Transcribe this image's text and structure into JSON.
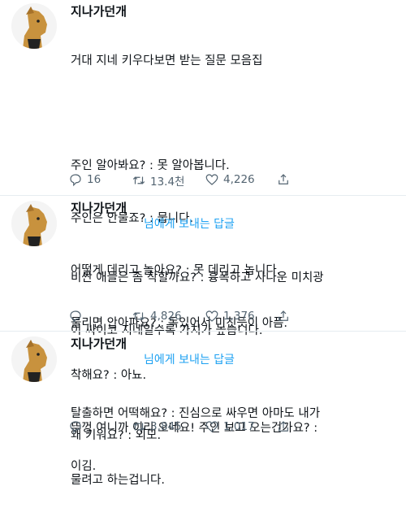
{
  "tweets": [
    {
      "author": "지나가던개",
      "lines": [
        "거대 지네 키우다보면 받는 질문 모음집",
        "",
        "주인 알아봐요? : 못 알아봅니다.",
        "주인은 안물죠? : 뭅니다.",
        "어떻게 데리고 놀아요? : 못 데리고 놉니다.",
        "물리면 안아파요? : 독있어서 미친듯이 아픔.",
        "착해요? : 아뇨.",
        "뚜껑 여니까 이리 오네요! 주인 보고 오는건가요? :",
        "물려고 하는겁니다."
      ],
      "reply": "16",
      "retweet": "13.4천",
      "like": "4,226"
    },
    {
      "author": "지나가던개",
      "replying_to": "님에게 보내는 답글",
      "lines": [
        "비싼 애들은 좀 착할까요? : 흉폭하고 사나운 미치광",
        "이 싸이코 지네일수록 가치가 높습니다.",
        "",
        "왜 키워요? : 외모."
      ],
      "retweet": "4,826",
      "like": "1,376"
    },
    {
      "author": "지나가던개",
      "replying_to": "님에게 보내는 답글",
      "lines": [
        "탈출하면 어떡해요? : 진심으로 싸우면 아마도 내가",
        "이김."
      ],
      "retweet": "3,845",
      "like": "1,017"
    }
  ]
}
